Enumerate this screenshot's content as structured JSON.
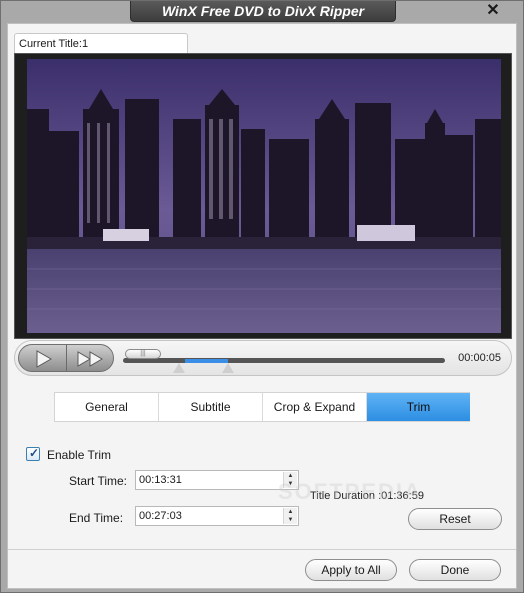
{
  "window": {
    "title": "WinX Free DVD to DivX Ripper"
  },
  "title_tab": {
    "label": "Current Title:1"
  },
  "player": {
    "time": "00:00:05",
    "position_fraction": 0.02
  },
  "tabs": [
    {
      "label": "General",
      "selected": false
    },
    {
      "label": "Subtitle",
      "selected": false
    },
    {
      "label": "Crop & Expand",
      "selected": false
    },
    {
      "label": "Trim",
      "selected": true
    }
  ],
  "trim": {
    "enable_label": "Enable Trim",
    "enabled": true,
    "start_label": "Start Time:",
    "start_value": "00:13:31",
    "end_label": "End Time:",
    "end_value": "00:27:03",
    "duration": "Title Duration :01:36:59",
    "reset_label": "Reset"
  },
  "footer": {
    "apply_label": "Apply to All",
    "done_label": "Done"
  },
  "watermark": "SOFTPEDIA",
  "colors": {
    "accent": "#3a8ee6",
    "tab_selected": "#4aa3ef"
  },
  "icons": {
    "close": "close-icon",
    "play": "play-icon",
    "fast_forward": "fast-forward-icon",
    "check": "check-icon"
  }
}
